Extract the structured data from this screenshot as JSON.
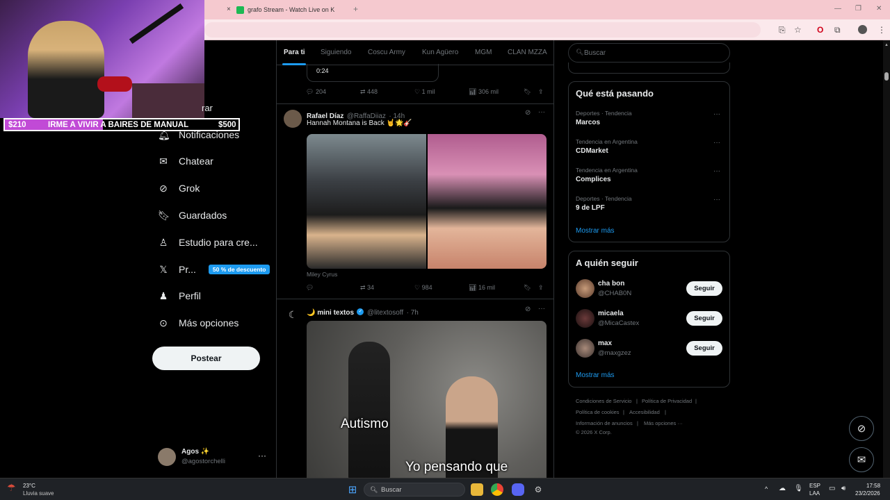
{
  "browser": {
    "tab_title": "grafo Stream - Watch Live on K",
    "new_tab": "+",
    "close_tab": "×"
  },
  "stream": {
    "goal_start": "$210",
    "goal_text": "IRME A VIVIR A BAIRES DE MANUAL",
    "goal_end": "$500",
    "goal_progress": 0.42
  },
  "nav": {
    "partial_item": "rar",
    "notifications": "Notificaciones",
    "chat": "Chatear",
    "grok": "Grok",
    "saved": "Guardados",
    "studio": "Estudio para cre...",
    "premium": "Pr...",
    "premium_badge": "50 % de descuento",
    "profile": "Perfil",
    "more": "Más opciones",
    "post_button": "Postear",
    "account_name": "Agos ✨",
    "account_handle": "@agostorchelli",
    "account_more": "···"
  },
  "feed": {
    "tabs": [
      "Para ti",
      "Siguiendo",
      "Coscu Army",
      "Kun Agüero",
      "MGM",
      "CLAN MZZA"
    ],
    "active_tab": "Para ti",
    "prev_post": {
      "video_time": "0:24",
      "replies": "204",
      "reposts": "448",
      "likes": "1 mil",
      "views": "306 mil"
    },
    "post1": {
      "name": "Rafael Díaz",
      "handle": "@RaffaDiiaz",
      "time": "· 14h",
      "text": "Hannah Montana is Back 🤘🌟🎸",
      "caption": "Miley Cyrus",
      "replies": "",
      "reposts": "34",
      "likes": "984",
      "views": "16 mil"
    },
    "post2": {
      "name": "🌙 mini textos",
      "handle": "@litextosoff",
      "time": "· 7h",
      "meme_top": "Autismo",
      "meme_bottom": "Yo pensando que"
    }
  },
  "right": {
    "search_placeholder": "Buscar",
    "trending_title": "Qué está pasando",
    "trends": [
      {
        "meta": "Deportes · Tendencia",
        "term": "Marcos"
      },
      {
        "meta": "Tendencia en Argentina",
        "term": "CDMarket"
      },
      {
        "meta": "Tendencia en Argentina",
        "term": "Complices"
      },
      {
        "meta": "Deportes · Tendencia",
        "term": "9 de LPF"
      }
    ],
    "trend_dots": "···",
    "show_more": "Mostrar más",
    "follow_title": "A quién seguir",
    "who_to_follow": [
      {
        "name": "cha bon",
        "handle": "@CHAB0N",
        "button": "Seguir"
      },
      {
        "name": "micaela",
        "handle": "@MicaCastex",
        "button": "Seguir"
      },
      {
        "name": "max",
        "handle": "@maxgzez",
        "button": "Seguir"
      }
    ],
    "footer": {
      "terms": "Condiciones de Servicio",
      "privacy": "Política de Privacidad",
      "cookies": "Política de cookies",
      "accessibility": "Accesibilidad",
      "ads": "Información de anuncios",
      "more": "Más opciones ···",
      "copyright": "© 2026 X Corp."
    }
  },
  "taskbar": {
    "weather_temp": "23°C",
    "weather_desc": "Lluvia suave",
    "search": "Buscar",
    "lang_top": "ESP",
    "lang_bottom": "LAA",
    "time": "17:58",
    "date": "23/2/2026"
  },
  "colors": {
    "accent": "#1d9bf0",
    "tabbar": "#f5c9cf",
    "goal_fill": "#c14ad6"
  }
}
